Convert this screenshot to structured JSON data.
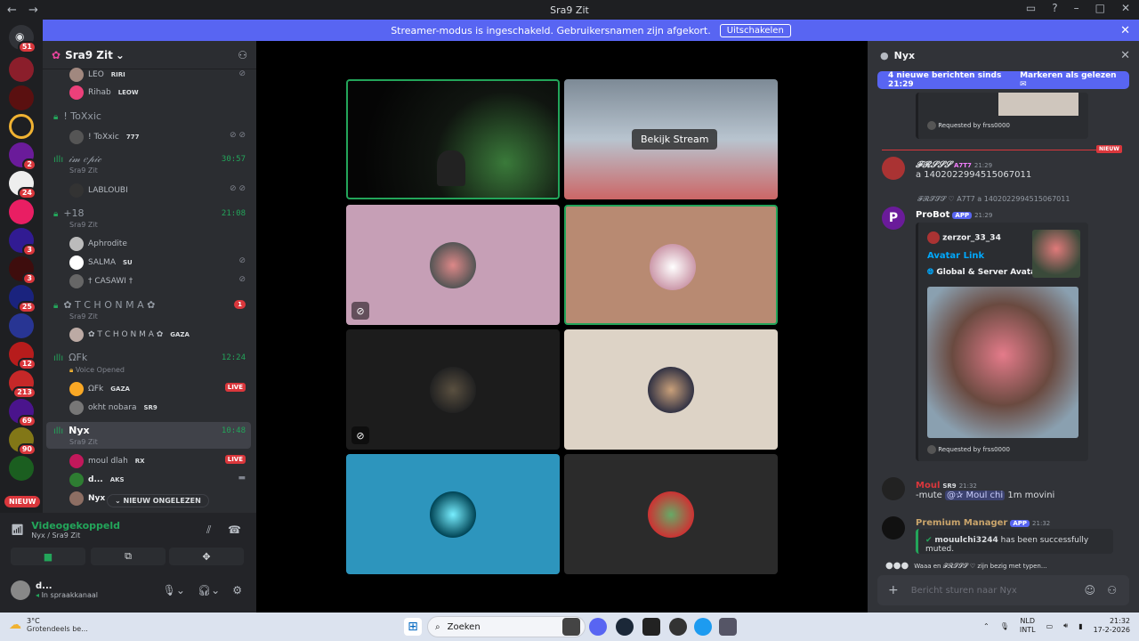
{
  "window": {
    "title": "Sra9 Zit"
  },
  "banner": {
    "text": "Streamer-modus is ingeschakeld. Gebruikersnamen zijn afgekort.",
    "button": "Uitschakelen"
  },
  "rail": {
    "badges": [
      "51",
      "2",
      "24",
      "3",
      "3",
      "25",
      "12",
      "213",
      "69",
      "90"
    ],
    "new_label": "NIEUW"
  },
  "server": {
    "name": "Sra9 Zit"
  },
  "channels": {
    "users_top": [
      {
        "name": "LEO",
        "tag": "RIRI"
      },
      {
        "name": "Rihab",
        "tag": "LEOW"
      }
    ],
    "toxxic": {
      "name": "! ToXxic",
      "user": "! ToXxic",
      "user_tag": "777"
    },
    "imepic": {
      "name": "𝒾𝓂 𝑒𝓅𝒾𝒸",
      "sub": "Sra9 Zit",
      "time": "30:57",
      "user": "LABLOUBI"
    },
    "plus18": {
      "name": "+18",
      "sub": "Sra9 Zit",
      "time": "21:08",
      "users": [
        {
          "name": "Aphrodite",
          "tag": ""
        },
        {
          "name": "SALMA",
          "tag": "SU"
        },
        {
          "name": "† CASAWI †",
          "tag": ""
        }
      ]
    },
    "tchonma": {
      "name": "✿ T C H O N M A ✿",
      "sub": "Sra9 Zit",
      "badge": "1",
      "user": "✿ T C H O N M A ✿",
      "user_tag": "GAZA"
    },
    "afk": {
      "name": "ΩFk",
      "sub": "Voice Opened",
      "time": "12:24",
      "users": [
        {
          "name": "ΩFk",
          "tag": "GAZA",
          "live": "LIVE"
        },
        {
          "name": "okht nobara",
          "tag": "SR9"
        }
      ]
    },
    "nyx": {
      "name": "Nyx",
      "sub": "Sra9 Zit",
      "time": "10:48",
      "users": [
        {
          "name": "moul dlah",
          "tag": "RX",
          "live": "LIVE"
        },
        {
          "name": "d...",
          "tag": "AKS"
        },
        {
          "name": "Nyx",
          "tag": ""
        }
      ]
    },
    "unread_pill": "NIEUW ONGELEZEN"
  },
  "voice": {
    "status": "Videogekoppeld",
    "location": "Nyx / Sra9 Zit"
  },
  "userbar": {
    "name": "d...",
    "status": "In spraakkanaal"
  },
  "stage": {
    "watch_stream": "Bekijk Stream"
  },
  "chat": {
    "channel": "Nyx",
    "new_banner": "4 nieuwe berichten sinds 21:29",
    "mark_read": "Markeren als gelezen",
    "requested_by": "Requested by frss0000",
    "new_divider": "NIEUW",
    "msg1": {
      "author": "𝓕𝓡𝓢𝓢𝓢",
      "tag": "A7T7",
      "time": "21:29",
      "text": "a 1402022994515067011"
    },
    "reply_preview": "𝓕𝓡𝓢𝓢𝓢 ♡  A7T7  a 1402022994515067011",
    "msg2": {
      "author": "ProBot",
      "tag": "APP",
      "time": "21:29",
      "embed_author": "zerzor_33_34",
      "embed_title": "Avatar Link",
      "embed_field": "Global & Server Avatar",
      "footer": "Requested by frss0000"
    },
    "msg3": {
      "author": "Moul",
      "tag": "SR9",
      "time": "21:32",
      "text": "-mute",
      "mention": "@✰ Moul chi",
      "rest": "1m movini"
    },
    "msg4": {
      "author": "Premium Manager",
      "tag": "APP",
      "time": "21:32",
      "embed_user": "mouulchi3244",
      "embed_text": "has been successfully muted."
    },
    "typing": "Waaa en 𝓕𝓡𝓢𝓢𝓢 ♡ zijn bezig met typen...",
    "input_placeholder": "Bericht sturen naar Nyx"
  },
  "taskbar": {
    "temp": "3°C",
    "weather": "Grotendeels be...",
    "search": "Zoeken",
    "lang1": "NLD",
    "lang2": "INTL",
    "time": "21:32",
    "date": "17-2-2026"
  },
  "colors": {
    "accent": "#5865f2",
    "online": "#23a55a",
    "danger": "#da373c"
  }
}
